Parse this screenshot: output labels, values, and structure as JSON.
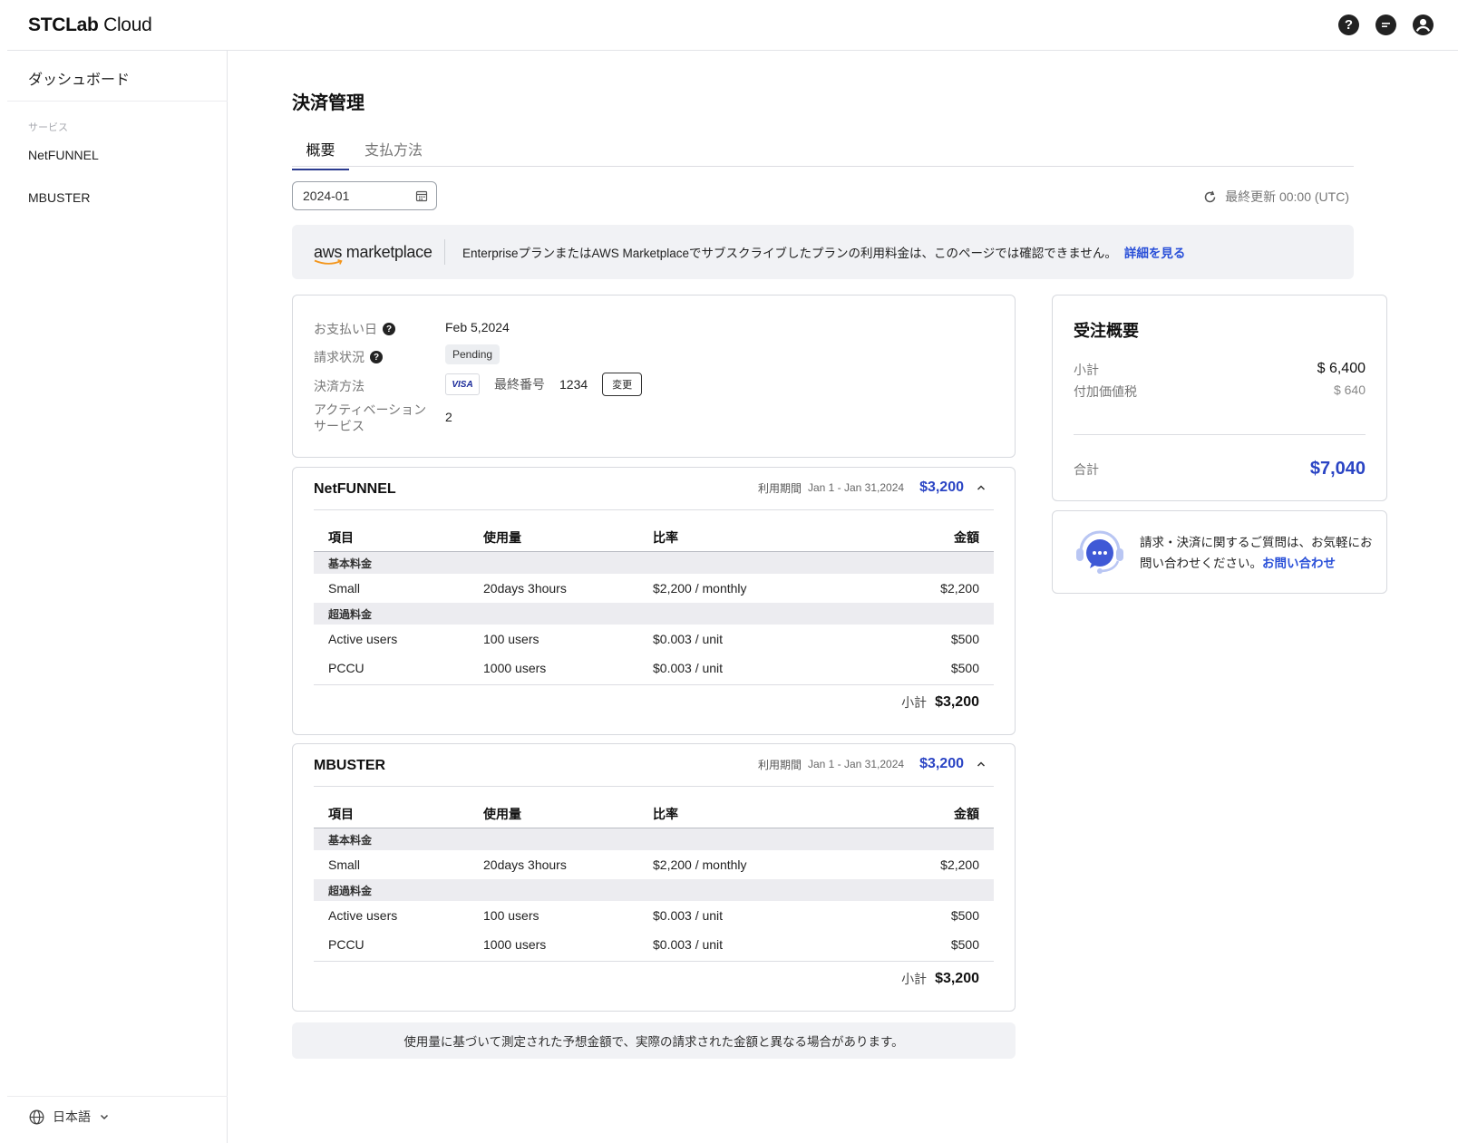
{
  "app": {
    "logo_bold": "STCLab",
    "logo_light": " Cloud"
  },
  "header": {
    "icons": [
      "help-icon",
      "chat-icon",
      "account-icon"
    ]
  },
  "sidebar": {
    "dashboard": "ダッシュボード",
    "section_label": "サービス",
    "items": [
      {
        "label": "NetFUNNEL"
      },
      {
        "label": "MBUSTER"
      }
    ],
    "language": "日本語"
  },
  "page": {
    "title": "決済管理",
    "tabs": [
      {
        "label": "概要",
        "active": true
      },
      {
        "label": "支払方法",
        "active": false
      }
    ],
    "month": "2024-01",
    "last_updated": "最終更新 00:00 (UTC)"
  },
  "aws_banner": {
    "logo_text": "aws marketplace",
    "text": "EnterpriseプランまたはAWS Marketplaceでサブスクライブしたプランの利用料金は、このページでは確認できません。",
    "link": "詳細を見る"
  },
  "payment_info": {
    "pay_date_label": "お支払い日",
    "pay_date": "Feb 5,2024",
    "status_label": "請求状況",
    "status": "Pending",
    "method_label": "決済方法",
    "card_brand": "VISA",
    "last_digits_label": "最終番号",
    "last_digits": "1234",
    "change_button": "変更",
    "active_services_label_1": "アクティベーション",
    "active_services_label_2": "サービス",
    "active_services": "2"
  },
  "order_summary": {
    "title": "受注概要",
    "subtotal_label": "小計",
    "subtotal": "$ 6,400",
    "vat_label": "付加価値税",
    "vat": "$ 640",
    "total_label": "合計",
    "total": "$7,040"
  },
  "contact": {
    "text": "請求・決済に関するご質問は、お気軽にお問い合わせください。",
    "link": "お問い合わせ"
  },
  "table_headers": {
    "item": "項目",
    "usage": "使用量",
    "rate": "比率",
    "amount": "金額"
  },
  "services": [
    {
      "name": "NetFUNNEL",
      "period_label": "利用期間",
      "period": "Jan 1 - Jan 31,2024",
      "amount": "$3,200",
      "base_group": "基本料金",
      "base": {
        "item": "Small",
        "usage": "20days 3hours",
        "rate": "$2,200 / monthly",
        "amount": "$2,200"
      },
      "over_group": "超過料金",
      "over": [
        {
          "item": "Active users",
          "usage": "100 users",
          "rate": "$0.003 / unit",
          "amount": "$500"
        },
        {
          "item": "PCCU",
          "usage": "1000 users",
          "rate": "$0.003 / unit",
          "amount": "$500"
        }
      ],
      "subtotal_label": "小計",
      "subtotal": "$3,200"
    },
    {
      "name": "MBUSTER",
      "period_label": "利用期間",
      "period": "Jan 1 - Jan 31,2024",
      "amount": "$3,200",
      "base_group": "基本料金",
      "base": {
        "item": "Small",
        "usage": "20days 3hours",
        "rate": "$2,200 / monthly",
        "amount": "$2,200"
      },
      "over_group": "超過料金",
      "over": [
        {
          "item": "Active users",
          "usage": "100 users",
          "rate": "$0.003 / unit",
          "amount": "$500"
        },
        {
          "item": "PCCU",
          "usage": "1000 users",
          "rate": "$0.003 / unit",
          "amount": "$500"
        }
      ],
      "subtotal_label": "小計",
      "subtotal": "$3,200"
    }
  ],
  "notice": "使用量に基づいて測定された予想金額で、実際の請求された金額と異なる場合があります。",
  "colors": {
    "accent": "#2a44c4",
    "link": "#2a50d8",
    "tab_underline": "#2b3b8f"
  }
}
